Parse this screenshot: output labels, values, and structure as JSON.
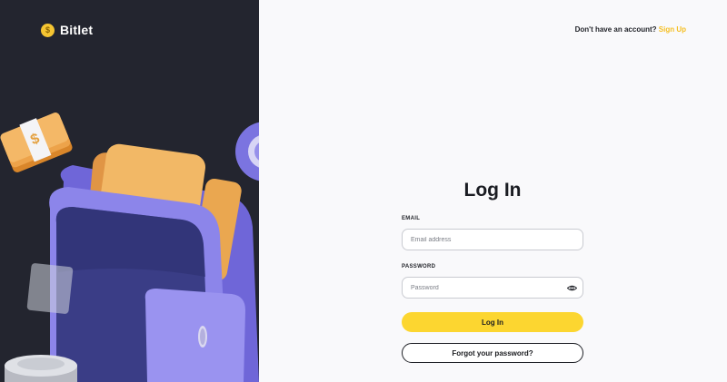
{
  "brand": {
    "name": "Bitlet",
    "logo_icon": "coin-icon"
  },
  "header": {
    "prompt": "Don't have an account?",
    "signup_label": "Sign Up"
  },
  "form": {
    "title": "Log In",
    "email_label": "EMAIL",
    "email_placeholder": "Email address",
    "email_value": "",
    "password_label": "PASSWORD",
    "password_placeholder": "Password",
    "password_value": "",
    "login_label": "Log In",
    "forgot_label": "Forgot your password?"
  },
  "colors": {
    "accent": "#fcd630",
    "link": "#f5bf23",
    "dark_panel": "#23252f",
    "page_bg": "#f9f9fb"
  }
}
